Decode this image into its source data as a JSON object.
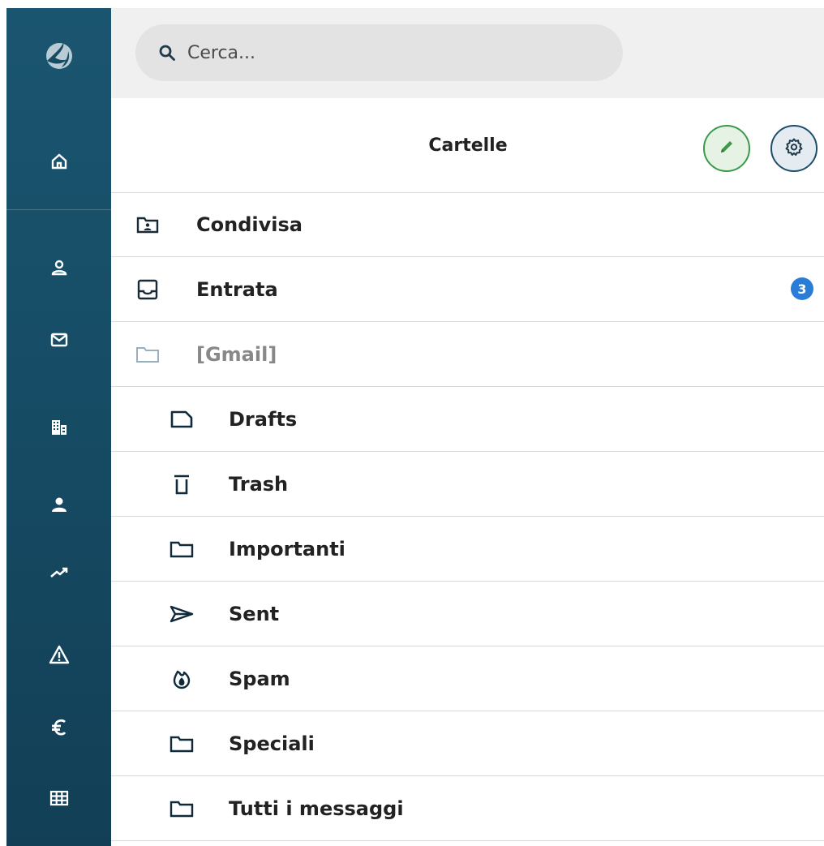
{
  "search": {
    "placeholder": "Cerca..."
  },
  "header": {
    "title": "Cartelle",
    "edit_icon": "pencil-icon",
    "settings_icon": "gear-icon"
  },
  "rail": {
    "items": [
      {
        "icon": "logo-icon"
      },
      {
        "icon": "home-icon"
      },
      {
        "icon": "contacts-icon"
      },
      {
        "icon": "mail-icon"
      },
      {
        "icon": "building-icon"
      },
      {
        "icon": "person-icon"
      },
      {
        "icon": "trend-icon"
      },
      {
        "icon": "warning-icon"
      },
      {
        "icon": "euro-icon"
      },
      {
        "icon": "table-icon"
      }
    ]
  },
  "folders": [
    {
      "label": "Condivisa",
      "icon": "shared-folder-icon"
    },
    {
      "label": "Entrata",
      "icon": "inbox-icon",
      "badge": "3"
    },
    {
      "label": "[Gmail]",
      "icon": "folder-icon"
    },
    {
      "label": "Drafts",
      "icon": "drafts-icon"
    },
    {
      "label": "Trash",
      "icon": "trash-icon"
    },
    {
      "label": "Importanti",
      "icon": "folder-icon"
    },
    {
      "label": "Sent",
      "icon": "send-icon"
    },
    {
      "label": "Spam",
      "icon": "spam-icon"
    },
    {
      "label": "Speciali",
      "icon": "folder-icon"
    },
    {
      "label": "Tutti i messaggi",
      "icon": "folder-icon"
    }
  ],
  "colors": {
    "rail": "#164b64",
    "accent_green": "#3a9a4a",
    "badge_blue": "#2a7dd6",
    "icon_dark": "#1f4e6a"
  }
}
